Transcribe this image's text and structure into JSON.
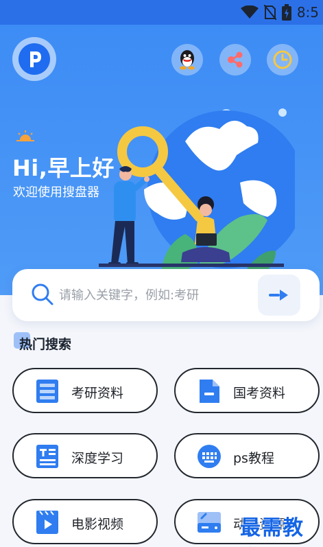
{
  "status_bar": {
    "time": "8:5",
    "icons": [
      "wifi-icon",
      "no-sim-icon",
      "battery-charging-icon"
    ]
  },
  "header": {
    "logo": "P",
    "actions": [
      {
        "name": "qq-button",
        "icon": "qq-penguin-icon"
      },
      {
        "name": "share-button",
        "icon": "share-icon"
      },
      {
        "name": "history-button",
        "icon": "clock-icon"
      }
    ]
  },
  "hero": {
    "greeting": "Hi,早上好",
    "subtitle": "欢迎使用搜盘器"
  },
  "search": {
    "placeholder": "请输入关键字，例如:考研"
  },
  "hot_search": {
    "title": "热门搜索",
    "categories": [
      {
        "label": "考研资料",
        "icon": "list-doc-icon"
      },
      {
        "label": "国考资料",
        "icon": "document-icon"
      },
      {
        "label": "深度学习",
        "icon": "text-doc-icon"
      },
      {
        "label": "ps教程",
        "icon": "keyboard-icon"
      },
      {
        "label": "电影视频",
        "icon": "video-icon"
      },
      {
        "label": "动漫资源",
        "icon": "drive-icon"
      }
    ]
  },
  "colors": {
    "brand_blue": "#2c70e8",
    "hero_blue": "#4f9bf7",
    "icon_blue": "#2f7df0"
  },
  "watermark": "最需教育"
}
